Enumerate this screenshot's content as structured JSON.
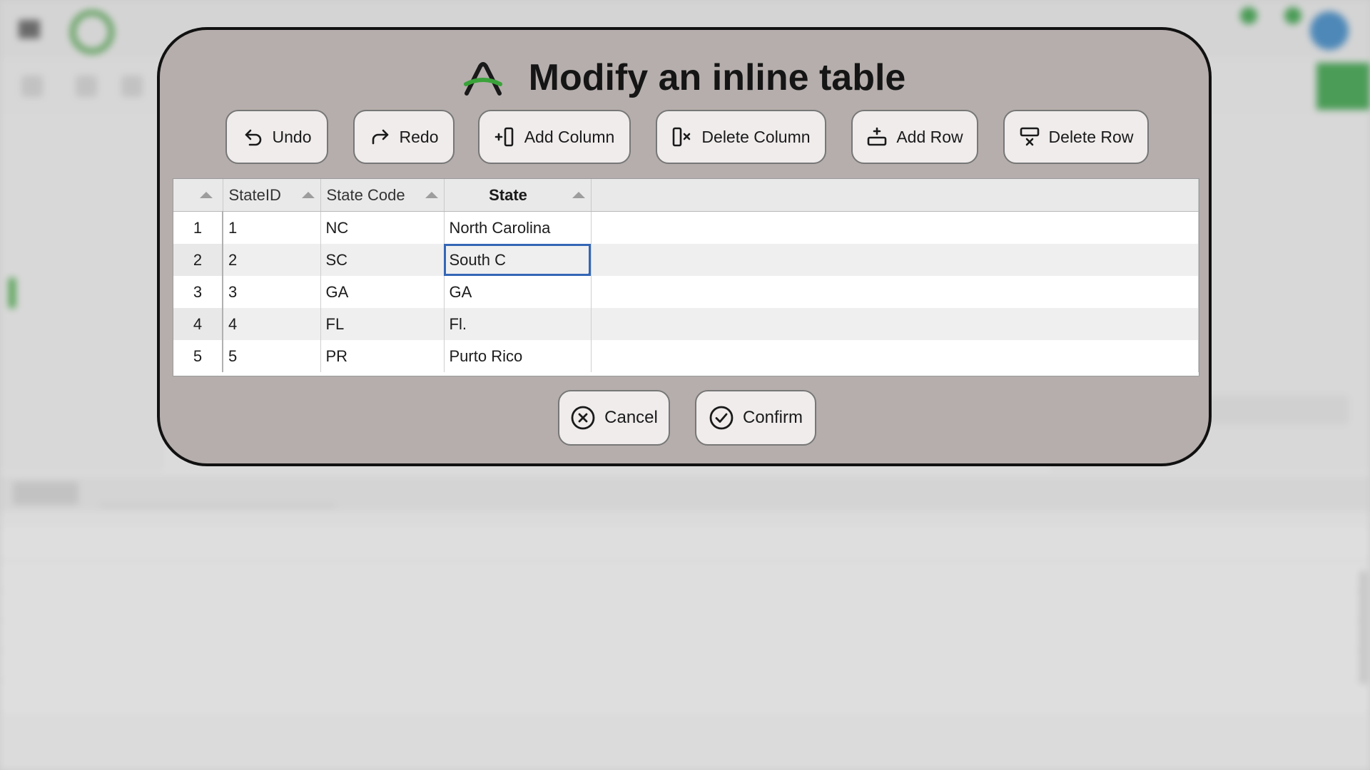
{
  "dialog": {
    "title": "Modify an inline table",
    "icon": "qlik-arch-logo-icon"
  },
  "toolbar": {
    "undo_label": "Undo",
    "redo_label": "Redo",
    "add_column_label": "Add Column",
    "delete_column_label": "Delete Column",
    "add_row_label": "Add Row",
    "delete_row_label": "Delete Row"
  },
  "table": {
    "columns": [
      "StateID",
      "State Code",
      "State"
    ],
    "rows": [
      {
        "num": "1",
        "cells": [
          "1",
          "NC",
          "North Carolina"
        ]
      },
      {
        "num": "2",
        "cells": [
          "2",
          "SC",
          "South C"
        ]
      },
      {
        "num": "3",
        "cells": [
          "3",
          "GA",
          "GA"
        ]
      },
      {
        "num": "4",
        "cells": [
          "4",
          "FL",
          "Fl."
        ]
      },
      {
        "num": "5",
        "cells": [
          "5",
          "PR",
          "Purto Rico"
        ]
      }
    ],
    "selected_cell": {
      "row": 2,
      "column": "State"
    }
  },
  "actions": {
    "cancel_label": "Cancel",
    "confirm_label": "Confirm"
  },
  "colors": {
    "accent_green": "#3aa33a",
    "selection_blue": "#3466b6",
    "modal_bg": "#b5aeac"
  }
}
